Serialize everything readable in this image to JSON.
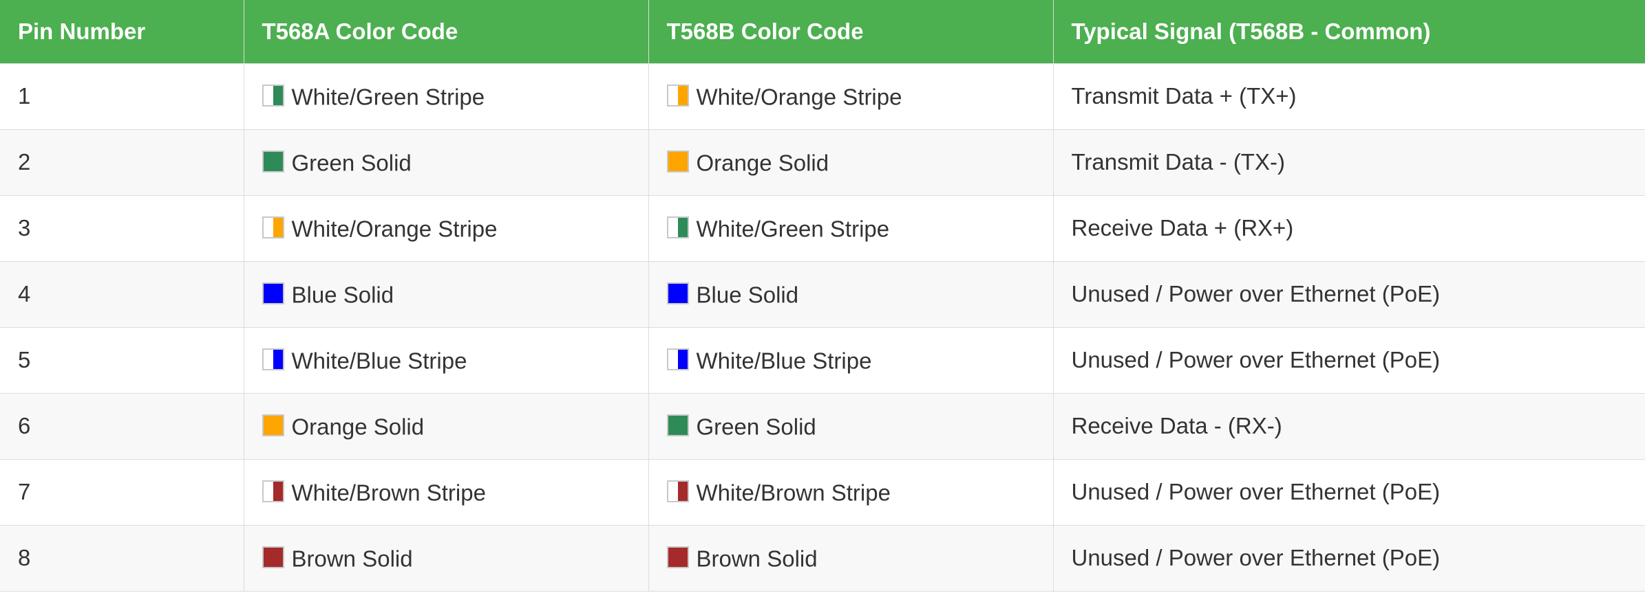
{
  "colors": {
    "header_bg": "#4caf50",
    "header_text": "#ffffff",
    "white": "#ffffff",
    "green": "#2e8b57",
    "orange": "#ffa500",
    "blue": "#0000ff",
    "brown": "#a52a2a"
  },
  "table": {
    "headers": [
      "Pin Number",
      "T568A Color Code",
      "T568B Color Code",
      "Typical Signal (T568B - Common)"
    ],
    "rows": [
      {
        "pin": "1",
        "t568a": {
          "label": "White/Green Stripe",
          "swatch": "stripe",
          "color": "#2e8b57"
        },
        "t568b": {
          "label": "White/Orange Stripe",
          "swatch": "stripe",
          "color": "#ffa500"
        },
        "signal": "Transmit Data + (TX+)"
      },
      {
        "pin": "2",
        "t568a": {
          "label": "Green Solid",
          "swatch": "solid",
          "color": "#2e8b57"
        },
        "t568b": {
          "label": "Orange Solid",
          "swatch": "solid",
          "color": "#ffa500"
        },
        "signal": "Transmit Data - (TX-)"
      },
      {
        "pin": "3",
        "t568a": {
          "label": "White/Orange Stripe",
          "swatch": "stripe",
          "color": "#ffa500"
        },
        "t568b": {
          "label": "White/Green Stripe",
          "swatch": "stripe",
          "color": "#2e8b57"
        },
        "signal": "Receive Data + (RX+)"
      },
      {
        "pin": "4",
        "t568a": {
          "label": "Blue Solid",
          "swatch": "solid",
          "color": "#0000ff"
        },
        "t568b": {
          "label": "Blue Solid",
          "swatch": "solid",
          "color": "#0000ff"
        },
        "signal": "Unused / Power over Ethernet (PoE)"
      },
      {
        "pin": "5",
        "t568a": {
          "label": "White/Blue Stripe",
          "swatch": "stripe",
          "color": "#0000ff"
        },
        "t568b": {
          "label": "White/Blue Stripe",
          "swatch": "stripe",
          "color": "#0000ff"
        },
        "signal": "Unused / Power over Ethernet (PoE)"
      },
      {
        "pin": "6",
        "t568a": {
          "label": "Orange Solid",
          "swatch": "solid",
          "color": "#ffa500"
        },
        "t568b": {
          "label": "Green Solid",
          "swatch": "solid",
          "color": "#2e8b57"
        },
        "signal": "Receive Data - (RX-)"
      },
      {
        "pin": "7",
        "t568a": {
          "label": "White/Brown Stripe",
          "swatch": "stripe",
          "color": "#a52a2a"
        },
        "t568b": {
          "label": "White/Brown Stripe",
          "swatch": "stripe",
          "color": "#a52a2a"
        },
        "signal": "Unused / Power over Ethernet (PoE)"
      },
      {
        "pin": "8",
        "t568a": {
          "label": "Brown Solid",
          "swatch": "solid",
          "color": "#a52a2a"
        },
        "t568b": {
          "label": "Brown Solid",
          "swatch": "solid",
          "color": "#a52a2a"
        },
        "signal": "Unused / Power over Ethernet (PoE)"
      }
    ]
  }
}
